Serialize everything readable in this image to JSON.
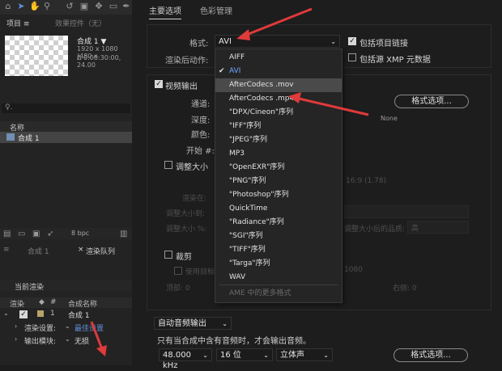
{
  "project_panel": {
    "tab_project": "项目 ≡",
    "tab_effects": "效果控件（无）",
    "comp_title": "合成 1 ▼",
    "comp_meta": [
      "1920 x 1080 (480 x",
      "Δ 0:00:30:00, 24.00"
    ],
    "search_placeholder": "♀.",
    "col_name": "名称",
    "item_name": "合成 1",
    "bpc": "8 bpc"
  },
  "render_queue": {
    "tab_comp": "合成 1",
    "tab_queue": "渲染队列",
    "current_render": "当前渲染",
    "col_render": "渲染",
    "col_comp_name": "合成名称",
    "row_index": "1",
    "row_comp": "合成 1",
    "render_settings_label": "渲染设置:",
    "render_settings_value": "最佳设置",
    "output_module_label": "输出模块:",
    "output_module_value": "无损"
  },
  "dialog": {
    "tab_main": "主要选项",
    "tab_color": "色彩管理",
    "format_label": "格式:",
    "format_value": "AVI",
    "post_render_label": "渲染后动作:",
    "include_project_link": "包括项目链接",
    "include_xmp": "包括源 XMP 元数据",
    "video_output": "视频输出",
    "channels_label": "通道:",
    "depth_label": "深度:",
    "color_label": "颜色:",
    "start_label": "开始 #:",
    "format_options_button": "格式选项...",
    "codec_none": "None",
    "resize_label": "调整大小",
    "resize_aspect": "16:9 (1.78)",
    "resize_to_label": "渲染在:",
    "resize_size_label": "调整大小到:",
    "resize_pct_label": "调整大小 %:",
    "resize_quality_label": "调整大小后的品质:",
    "resize_quality_value": "高",
    "crop_label": "裁剪",
    "use_target_label": "使用目标",
    "crop_top_label": "顶部: 0",
    "crop_right_label": "右侧: 0",
    "crop_size": "1080",
    "audio_auto": "自动音频输出",
    "audio_note": "只有当合成中含有音频时，才会输出音频。",
    "audio_rate": "48.000 kHz",
    "audio_bits": "16 位",
    "audio_channels": "立体声",
    "audio_format_button": "格式选项..."
  },
  "format_menu": {
    "items": [
      {
        "label": "AIFF"
      },
      {
        "label": "AVI",
        "selected": true
      },
      {
        "label": "AfterCodecs .mov",
        "highlight": true
      },
      {
        "label": "AfterCodecs .mp4"
      },
      {
        "label": "\"DPX/Cineon\"序列"
      },
      {
        "label": "\"IFF\"序列"
      },
      {
        "label": "\"JPEG\"序列"
      },
      {
        "label": "MP3"
      },
      {
        "label": "\"OpenEXR\"序列"
      },
      {
        "label": "\"PNG\"序列"
      },
      {
        "label": "\"Photoshop\"序列"
      },
      {
        "label": "QuickTime"
      },
      {
        "label": "\"Radiance\"序列"
      },
      {
        "label": "\"SGI\"序列"
      },
      {
        "label": "\"TIFF\"序列"
      },
      {
        "label": "\"Targa\"序列"
      },
      {
        "label": "WAV"
      }
    ],
    "more_formats": "AME 中的更多格式"
  },
  "colors": {
    "accent_blue": "#6fa6ff",
    "annotation_red": "#e03a3a"
  }
}
